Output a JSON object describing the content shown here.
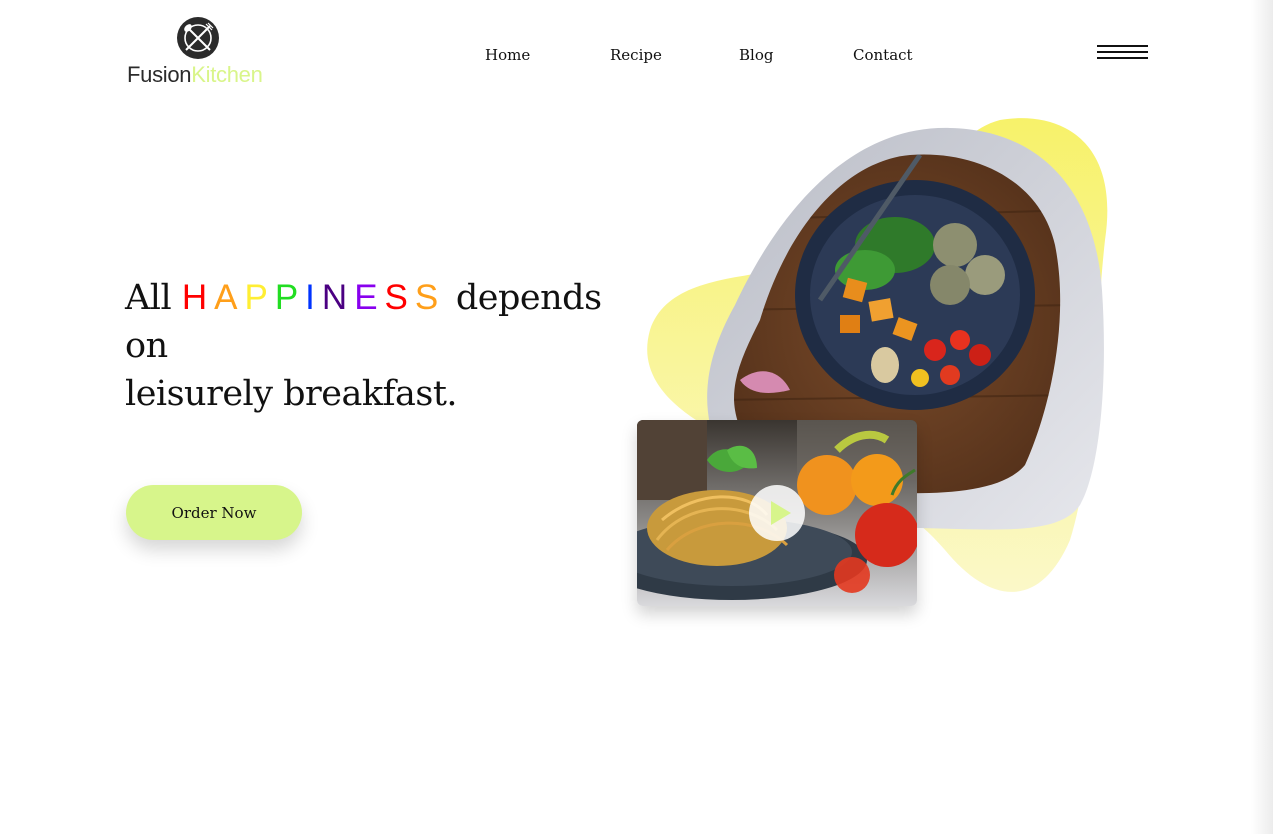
{
  "brand": {
    "name_part1": "Fusion",
    "name_part2": "Kitchen",
    "accent_color": "#d9f58a",
    "dark_color": "#2b2b2b",
    "logo_icon": "fork-and-knife-plate-icon"
  },
  "nav": {
    "items": [
      "Home",
      "Recipe",
      "Blog",
      "Contact"
    ]
  },
  "menu": {
    "icon": "hamburger-menu-icon"
  },
  "hero": {
    "headline_prefix": "All",
    "headline_word_letters": [
      "H",
      "A",
      "P",
      "P",
      "I",
      "N",
      "E",
      "S",
      "S"
    ],
    "headline_word_colors": [
      "#ff0000",
      "#ff9f1a",
      "#ffee33",
      "#22dd22",
      "#0033ff",
      "#4b0082",
      "#8800ee",
      "#ff0000",
      "#ff9f1a"
    ],
    "headline_mid": "depends",
    "headline_line2": "on",
    "headline_line3": "leisurely breakfast.",
    "cta_label": "Order Now",
    "cta_color": "#d7f58b",
    "play_icon": "play-icon"
  }
}
